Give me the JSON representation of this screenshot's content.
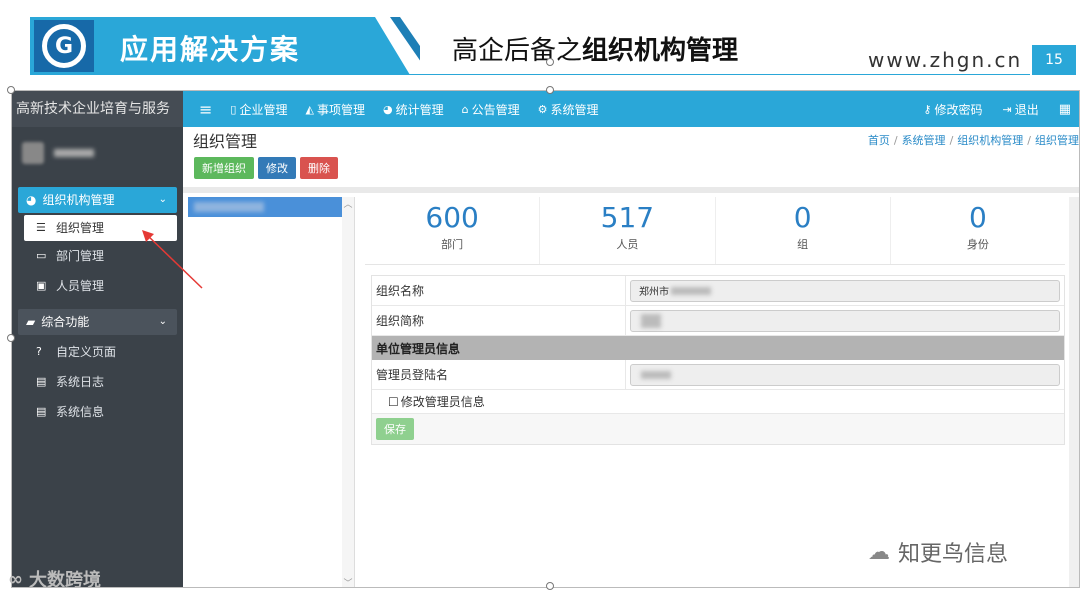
{
  "slide": {
    "banner_title": "应用解决方案",
    "title_prefix": "高企后备之",
    "title_bold": "组织机构管理",
    "site_url": "www.zhgn.cn",
    "page_number": "15"
  },
  "sidebar": {
    "title": "高新技术企业培育与服务",
    "groups": [
      {
        "label": "组织机构管理",
        "icon": "pie-chart-icon",
        "items": [
          {
            "label": "组织管理",
            "icon": "list-icon"
          },
          {
            "label": "部门管理",
            "icon": "folder-icon"
          },
          {
            "label": "人员管理",
            "icon": "id-card-icon"
          }
        ]
      },
      {
        "label": "综合功能",
        "icon": "folder-open-icon",
        "items": [
          {
            "label": "自定义页面",
            "icon": "question-icon"
          },
          {
            "label": "系统日志",
            "icon": "file-icon"
          },
          {
            "label": "系统信息",
            "icon": "file-icon"
          }
        ]
      }
    ]
  },
  "topbar": {
    "menu_icon": "≡",
    "items": [
      {
        "label": "企业管理",
        "icon": "document-icon"
      },
      {
        "label": "事项管理",
        "icon": "area-chart-icon"
      },
      {
        "label": "统计管理",
        "icon": "pie-chart-icon"
      },
      {
        "label": "公告管理",
        "icon": "home-icon"
      },
      {
        "label": "系统管理",
        "icon": "gears-icon"
      }
    ],
    "change_password": "修改密码",
    "logout": "退出"
  },
  "page": {
    "title": "组织管理",
    "breadcrumb": [
      "首页",
      "系统管理",
      "组织机构管理",
      "组织管理"
    ],
    "buttons": {
      "add_org": "新增组织",
      "edit": "修改",
      "delete": "删除"
    }
  },
  "stats": [
    {
      "value": "600",
      "label": "部门"
    },
    {
      "value": "517",
      "label": "人员"
    },
    {
      "value": "0",
      "label": "组"
    },
    {
      "value": "0",
      "label": "身份"
    }
  ],
  "form": {
    "org_name_label": "组织名称",
    "org_name_value": "郑州市",
    "org_short_label": "组织简称",
    "admin_section": "单位管理员信息",
    "admin_login_label": "管理员登陆名",
    "edit_admin_checkbox": "修改管理员信息",
    "save_button": "保存"
  },
  "watermarks": {
    "left": "大数跨境",
    "right": "知更鸟信息"
  },
  "colors": {
    "accent": "#2aa7d8",
    "sidebar": "#3b4249",
    "stat_value": "#2a7fc4"
  }
}
